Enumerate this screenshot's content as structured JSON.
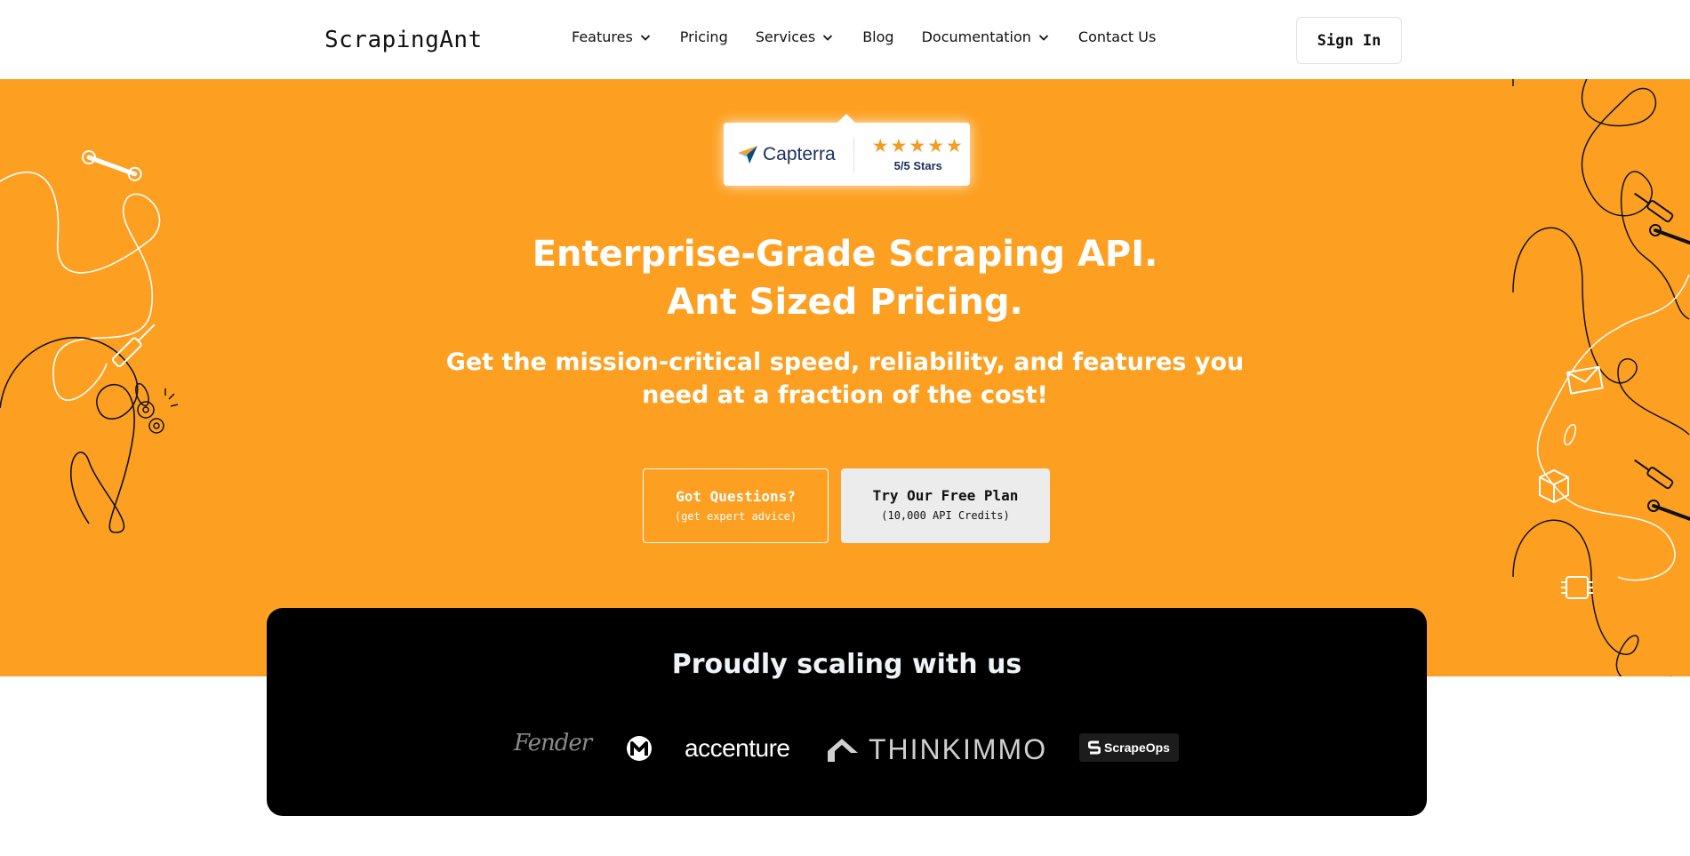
{
  "header": {
    "logo": "ScrapingAnt",
    "nav": [
      {
        "label": "Features",
        "dropdown": true
      },
      {
        "label": "Pricing",
        "dropdown": false
      },
      {
        "label": "Services",
        "dropdown": true
      },
      {
        "label": "Blog",
        "dropdown": false
      },
      {
        "label": "Documentation",
        "dropdown": true
      },
      {
        "label": "Contact Us",
        "dropdown": false
      }
    ],
    "sign_in": "Sign In"
  },
  "hero": {
    "background_color": "#fda021",
    "capterra": {
      "brand": "Capterra",
      "stars": "★★★★★",
      "rating_text": "5/5 Stars",
      "rating": 5
    },
    "headline_line1": "Enterprise-Grade Scraping API.",
    "headline_line2": "Ant Sized Pricing.",
    "subline_line1": "Get the mission-critical speed, reliability, and features you",
    "subline_line2": "need at a fraction of the cost!",
    "cta_questions": {
      "label": "Got Questions?",
      "sub": "(get expert advice)"
    },
    "cta_free": {
      "label": "Try Our Free Plan",
      "sub": "(10,000 API Credits)"
    }
  },
  "clients": {
    "title": "Proudly scaling with us",
    "logos": [
      "Fender",
      "M",
      "accenture",
      "THINKIMMO",
      "ScrapeOps"
    ]
  }
}
